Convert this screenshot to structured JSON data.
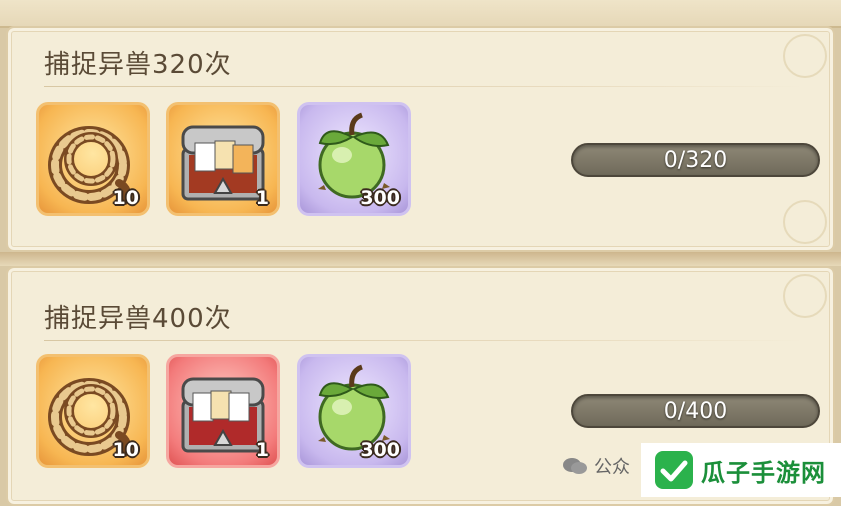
{
  "quests": [
    {
      "title": "捕捉异兽320次",
      "progress_text": "0/320",
      "progress_fraction": 0,
      "rewards": [
        {
          "icon": "rope-icon",
          "quantity": "10",
          "rarity_color": "#f7b652"
        },
        {
          "icon": "treasure-chest-icon",
          "quantity": "1",
          "rarity_color": "#f7b652"
        },
        {
          "icon": "green-fruit-icon",
          "quantity": "300",
          "rarity_color": "#c8b8ee"
        }
      ]
    },
    {
      "title": "捕捉异兽400次",
      "progress_text": "0/400",
      "progress_fraction": 0,
      "rewards": [
        {
          "icon": "rope-icon",
          "quantity": "10",
          "rarity_color": "#f7b652"
        },
        {
          "icon": "treasure-chest-icon",
          "quantity": "1",
          "rarity_color": "#f37b7b"
        },
        {
          "icon": "green-fruit-icon",
          "quantity": "300",
          "rarity_color": "#c8b8ee"
        }
      ]
    }
  ],
  "watermark": {
    "text": "公众"
  },
  "brand": {
    "text": "瓜子手游网"
  }
}
